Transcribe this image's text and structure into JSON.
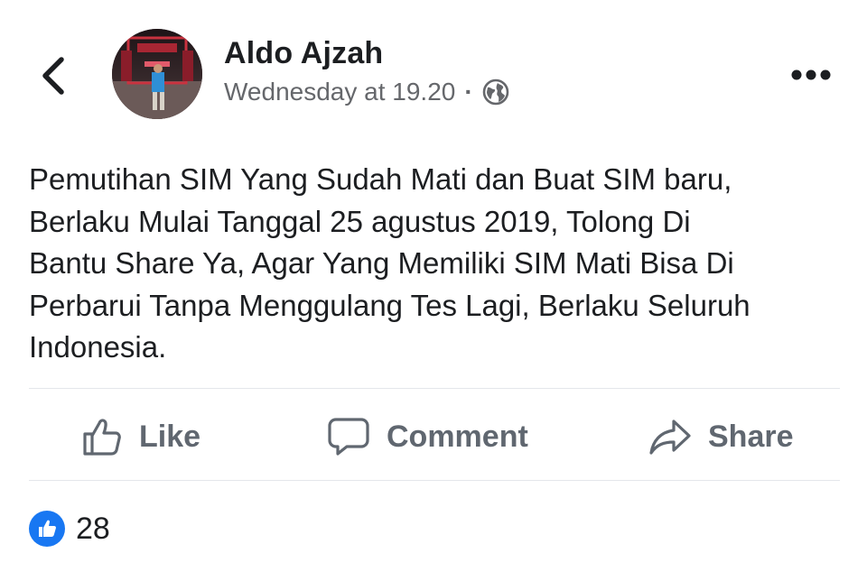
{
  "post": {
    "author": "Aldo Ajzah",
    "timestamp": "Wednesday at 19.20",
    "separator": "·",
    "privacy_icon": "globe-icon",
    "text": "Pemutihan SIM Yang Sudah Mati dan Buat SIM baru,\nBerlaku Mulai Tanggal 25 agustus 2019, Tolong Di\nBantu Share Ya, Agar Yang Memiliki SIM Mati Bisa Di\nPerbarui Tanpa Menggulang Tes Lagi, Berlaku Seluruh\nIndonesia."
  },
  "header": {
    "back_icon": "chevron-left-icon",
    "more_icon": "more-options-icon"
  },
  "actions": {
    "like_label": "Like",
    "comment_label": "Comment",
    "share_label": "Share"
  },
  "reactions": {
    "count": "28",
    "icon": "like-reaction-icon"
  },
  "colors": {
    "accent": "#1877f2",
    "text": "#1c1e21",
    "secondary_text": "#65676b",
    "divider": "#e4e6eb"
  }
}
